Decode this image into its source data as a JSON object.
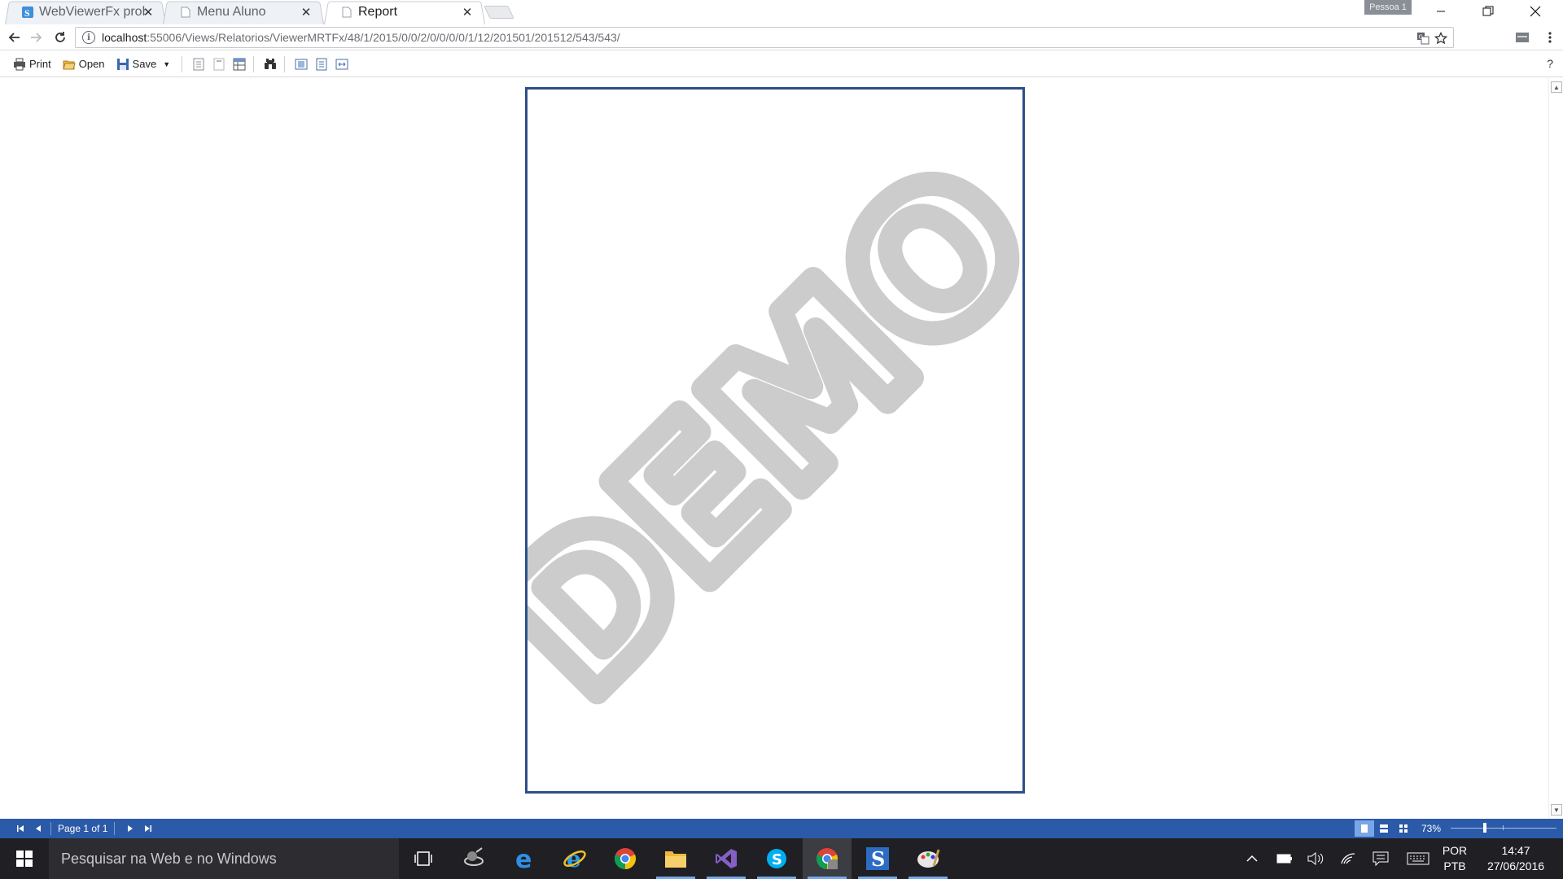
{
  "browser": {
    "tabs": [
      {
        "title": "WebViewerFx probl",
        "favicon": "stackoverflow-s-icon",
        "active": false
      },
      {
        "title": "Menu Aluno",
        "favicon": "document-icon",
        "active": false
      },
      {
        "title": "Report",
        "favicon": "document-icon",
        "active": true
      }
    ],
    "profile_label": "Pessoa 1",
    "url_host": "localhost",
    "url_rest": ":55006/Views/Relatorios/ViewerMRTFx/48/1/2015/0/0/2/0/0/0/0/1/12/201501/201512/543/543/"
  },
  "toolbar": {
    "print_label": "Print",
    "open_label": "Open",
    "save_label": "Save",
    "help_label": "?"
  },
  "report": {
    "watermark": "DEMO"
  },
  "statusbar": {
    "page_info": "Page 1 of 1",
    "zoom": "73%",
    "zoom_level_percent": 73
  },
  "taskbar": {
    "search_placeholder": "Pesquisar na Web e no Windows",
    "lang_line1": "POR",
    "lang_line2": "PTB",
    "time": "14:47",
    "date": "27/06/2016",
    "apps": [
      "task-view-icon",
      "satellite-app-icon",
      "edge-icon",
      "internet-explorer-icon",
      "chrome-icon",
      "file-explorer-icon",
      "visual-studio-icon",
      "skype-icon",
      "chrome-app-icon",
      "stimulsoft-icon",
      "paint-app-icon"
    ]
  },
  "colors": {
    "statusbar": "#2a5aa8",
    "page_border": "#2d4f8a",
    "watermark": "#cccccc",
    "taskbar": "#1f1f24"
  }
}
